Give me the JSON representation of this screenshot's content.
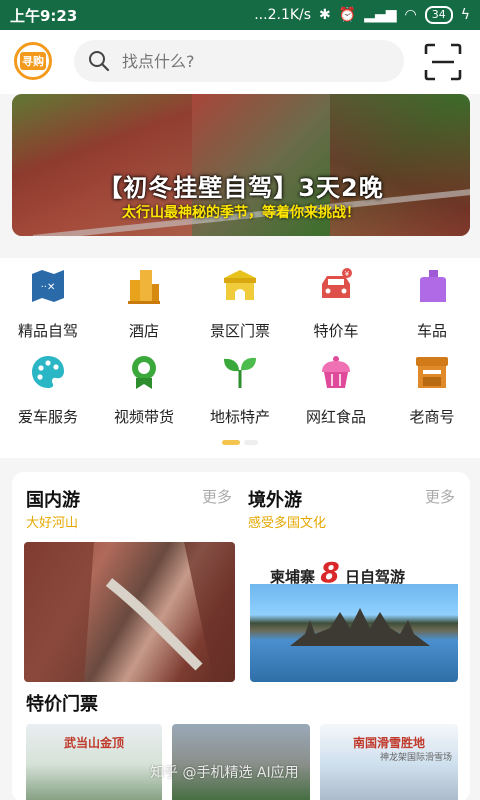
{
  "status": {
    "time": "上午9:23",
    "network_speed": "...2.1K/s",
    "battery": "34"
  },
  "header": {
    "logo_text": "寻购",
    "search_placeholder": "找点什么?"
  },
  "banner": {
    "title": "【初冬挂壁自驾】3天2晚",
    "subtitle": "太行山最神秘的季节，等着你来挑战！"
  },
  "categories": [
    {
      "label": "精品自驾",
      "icon": "map-icon",
      "color": "#2a7bb8"
    },
    {
      "label": "酒店",
      "icon": "hotel-icon",
      "color": "#e8a21c"
    },
    {
      "label": "景区门票",
      "icon": "gate-icon",
      "color": "#e8c21c"
    },
    {
      "label": "特价车",
      "icon": "car-icon",
      "color": "#e0504a"
    },
    {
      "label": "车品",
      "icon": "bottle-icon",
      "color": "#a05ad6"
    },
    {
      "label": "爱车服务",
      "icon": "palette-icon",
      "color": "#2bb6c6"
    },
    {
      "label": "视频带货",
      "icon": "badge-icon",
      "color": "#3aa83a"
    },
    {
      "label": "地标特产",
      "icon": "sprout-icon",
      "color": "#3aa83a"
    },
    {
      "label": "网红食品",
      "icon": "cake-icon",
      "color": "#e04a9a"
    },
    {
      "label": "老商号",
      "icon": "shop-icon",
      "color": "#e08a2a"
    }
  ],
  "travel": {
    "domestic": {
      "title": "国内游",
      "subtitle": "大好河山",
      "more": "更多"
    },
    "abroad": {
      "title": "境外游",
      "subtitle": "感受多国文化",
      "more": "更多",
      "tag_prefix": "柬埔寨",
      "tag_number": "8",
      "tag_suffix": "日自驾游"
    }
  },
  "tickets": {
    "title": "特价门票",
    "items": [
      {
        "caption": "武当山金顶",
        "caption_color": "#c0392b"
      },
      {
        "caption": "",
        "caption_color": "#333"
      },
      {
        "caption": "南国滑雪胜地",
        "caption_color": "#c0392b",
        "subcaption": "神龙架国际滑雪场"
      }
    ]
  },
  "watermark": "知乎 @手机精选 AI应用"
}
